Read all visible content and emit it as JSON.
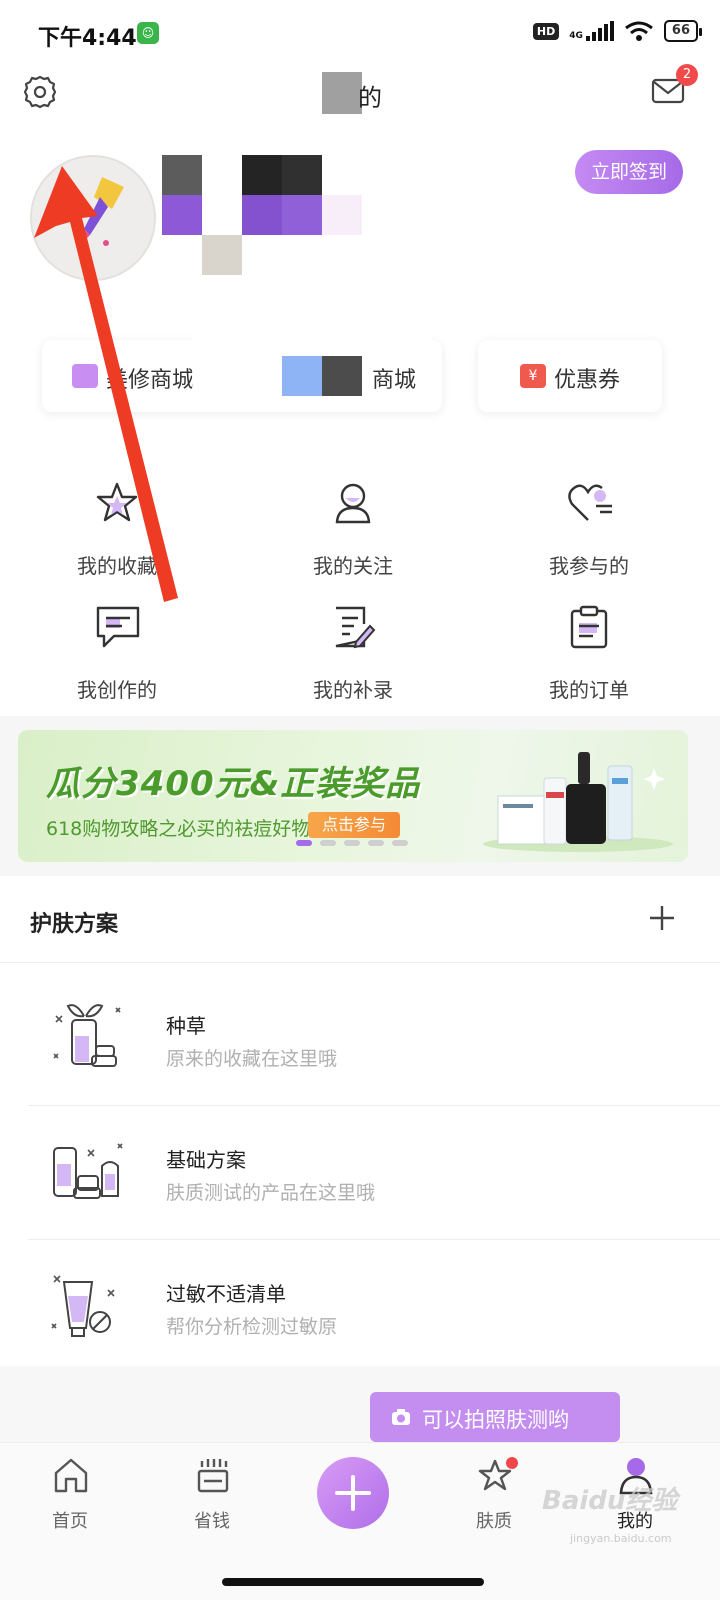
{
  "status_bar": {
    "time": "下午4:44",
    "hd": "HD",
    "network": "4G",
    "battery": "66"
  },
  "header": {
    "title_char": "的",
    "unread_count": "2"
  },
  "profile": {
    "checkin_label": "立即签到"
  },
  "shop_cards": [
    {
      "label": "美修商城"
    },
    {
      "label": "商城"
    },
    {
      "label": "优惠券",
      "icon_text": "¥"
    }
  ],
  "grid": [
    {
      "label": "我的收藏",
      "icon": "star-icon"
    },
    {
      "label": "我的关注",
      "icon": "person-icon"
    },
    {
      "label": "我参与的",
      "icon": "heart-icon"
    },
    {
      "label": "我创作的",
      "icon": "chat-bubble-icon"
    },
    {
      "label": "我的补录",
      "icon": "edit-note-icon"
    },
    {
      "label": "我的订单",
      "icon": "clipboard-icon"
    }
  ],
  "banner": {
    "headline": "瓜分3400元&正装奖品",
    "subtitle": "618购物攻略之必买的祛痘好物",
    "cta": "点击参与",
    "page_count": 5,
    "active_page": 1
  },
  "skincare": {
    "title": "护肤方案",
    "items": [
      {
        "title": "种草",
        "desc": "原来的收藏在这里哦"
      },
      {
        "title": "基础方案",
        "desc": "肤质测试的产品在这里哦"
      },
      {
        "title": "过敏不适清单",
        "desc": "帮你分析检测过敏原"
      }
    ]
  },
  "tooltip": {
    "label": "可以拍照肤测哟"
  },
  "tabs": [
    {
      "label": "首页"
    },
    {
      "label": "省钱"
    },
    {
      "label": "肤质"
    },
    {
      "label": "我的"
    }
  ],
  "watermark": {
    "brand": "Baidu经验",
    "url": "jingyan.baidu.com"
  },
  "colors": {
    "accent": "#b06ee9",
    "accent_light": "#c48df0",
    "badge_red": "#f04a4a",
    "arrow_red": "#ee3b24"
  }
}
